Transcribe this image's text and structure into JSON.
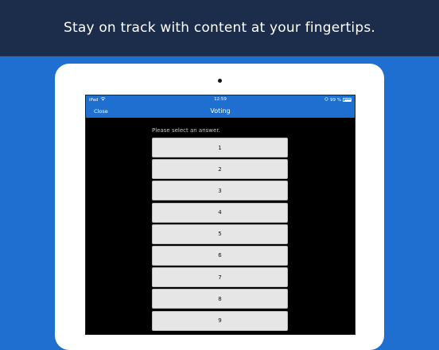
{
  "banner": {
    "title": "Stay on track with content at your fingertips."
  },
  "status_bar": {
    "device": "iPad",
    "wifi_icon": "wifi-icon",
    "time": "12:59",
    "battery_percent_text": "99 %",
    "battery_level": 0.99
  },
  "nav": {
    "close_label": "Close",
    "title": "Voting"
  },
  "voting": {
    "prompt": "Please select an answer.",
    "answers": [
      "1",
      "2",
      "3",
      "4",
      "5",
      "6",
      "7",
      "8",
      "9"
    ]
  },
  "colors": {
    "background": "#1f6fd1",
    "banner": "#1b2d4a",
    "nav_bar": "#1f6fd1",
    "screen": "#000000",
    "answer_button": "#e6e6e6"
  }
}
